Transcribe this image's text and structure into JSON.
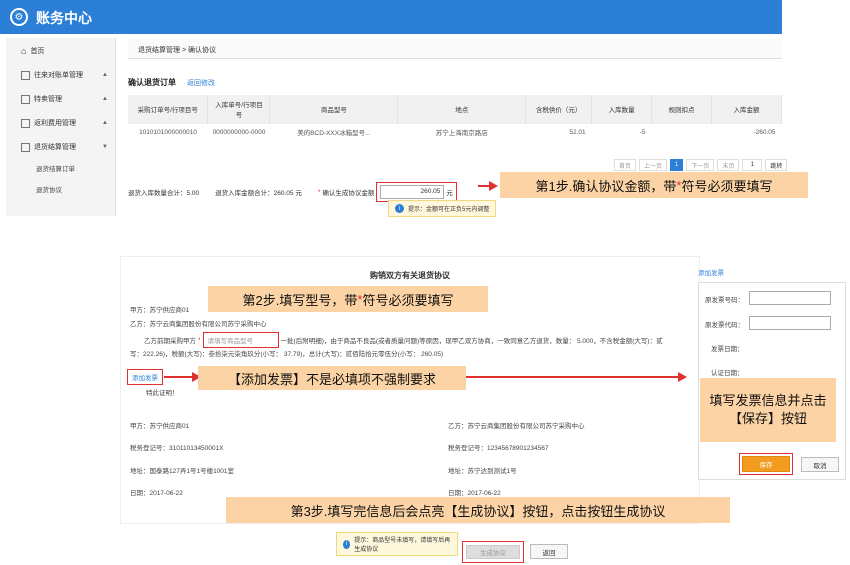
{
  "app": {
    "title": "账务中心"
  },
  "sidebar": {
    "items": [
      {
        "label": "首页",
        "caret": ""
      },
      {
        "label": "往来对账单管理",
        "caret": "▲"
      },
      {
        "label": "特卖管理",
        "caret": "▲"
      },
      {
        "label": "返利费用管理",
        "caret": "▲"
      },
      {
        "label": "退货结算管理",
        "caret": "▼"
      }
    ],
    "subitems": [
      {
        "label": "退货结算订单"
      },
      {
        "label": "退货协议"
      }
    ]
  },
  "breadcrumb": {
    "text": "退货结算管理 > 确认协议"
  },
  "order": {
    "title": "确认退货订单",
    "back_label": "返回修改",
    "columns": [
      "采购订单号/行项目号",
      "入库单号/行项目号",
      "商品型号",
      "地点",
      "含税供价（元）",
      "入库数量",
      "规则扣点",
      "入库金额"
    ],
    "row": [
      "1010101000000010",
      "0000000000-0000",
      "美的BCD-XXX冰箱型号...",
      "苏宁上海南京路店",
      "52.01",
      "-5",
      "",
      "-260.05"
    ]
  },
  "pager": {
    "first": "首页",
    "prev": "上一页",
    "current": "1",
    "next": "下一页",
    "last": "末页",
    "page_input": "1",
    "jump": "跳转"
  },
  "summary": {
    "qty": "退货入库数量合计：5.00",
    "amount": "退货入库金额合计：260.05 元",
    "confirm_label": "确认生成协议金额",
    "confirm_value": "260.05",
    "unit": "元",
    "tip": "提示：金额可在正负5元内调整"
  },
  "callouts": {
    "step1_pre": "第1步.确认协议金额，带",
    "step1_post": "符号必须要填写",
    "step2_pre": "第2步.填写型号，带",
    "step2_post": "符号必须要填写",
    "add_invoice_note": "【添加发票】不是必填项不强制要求",
    "fill_invoice": "填写发票信息并点击【保存】按钮",
    "step3": "第3步.填写完信息后会点亮【生成协议】按钮，点击按钮生成协议",
    "star": "*"
  },
  "agreement": {
    "title": "购销双方有关退货协议",
    "party_a": "甲方：苏宁供应商01",
    "party_b": "乙方：苏宁云商集团股份有限公司苏宁采购中心",
    "body1_pre": "乙方前期采购甲方",
    "model_placeholder": "请填写商品型号",
    "body1_post": "一批(后附明细)，由于商品不良品(或者质量问题)等原因，现甲乙双方协商，一致同意乙方退货，数量： 5.000，不含税金额(大写)：贰",
    "body2": "写：222.26)，税额(大写)：叁拾柒元柒角玖分(小写： 37.79)，总计(大写)：贰佰陆拾元零伍分(小写： 260.05)",
    "add_invoice": "添加发票",
    "proof": "特此证明！",
    "sig_a": "甲方：苏宁供应商01",
    "sig_b": "乙方：苏宁云商集团股份有限公司苏宁采购中心",
    "tax_a": "税务登记号：31011013450001X",
    "tax_b": "税务登记号：12345678901234567",
    "addr_a": "地址：国泰路127弄1号1号楼1001室",
    "addr_b": "地址：苏宁达到测试1号",
    "date_a": "日期：2017-06-22",
    "date_b": "日期：2017-06-22"
  },
  "invoice": {
    "header": "添加发票",
    "num_label": "原发票号码：",
    "code_label": "原发票代码：",
    "date_label": "发票日期：",
    "cert_label": "认证日期：",
    "save": "保存",
    "cancel": "取消"
  },
  "footer": {
    "tip": "提示：商品型号未填写，请填写后再生成协议",
    "generate": "生成协议",
    "back": "返回"
  },
  "colors": {
    "brand": "#2b7fd6",
    "callout": "#fbd3a4",
    "alert": "#e03030",
    "save": "#f29b1f"
  }
}
